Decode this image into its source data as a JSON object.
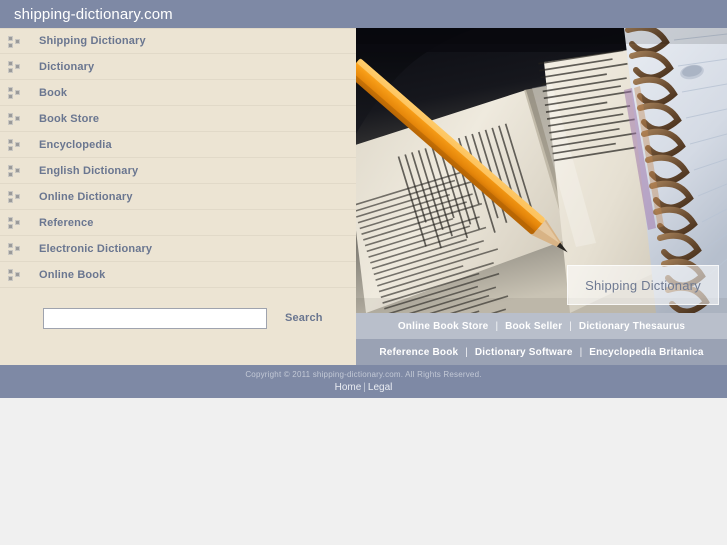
{
  "header": {
    "site_title": "shipping-dictionary.com"
  },
  "sidebar": {
    "nav_items": [
      {
        "label": "Shipping Dictionary",
        "icon": "squares-bullet-icon"
      },
      {
        "label": "Dictionary",
        "icon": "squares-bullet-icon"
      },
      {
        "label": "Book",
        "icon": "squares-bullet-icon"
      },
      {
        "label": "Book Store",
        "icon": "squares-bullet-icon"
      },
      {
        "label": "Encyclopedia",
        "icon": "squares-bullet-icon"
      },
      {
        "label": "English Dictionary",
        "icon": "squares-bullet-icon"
      },
      {
        "label": "Online Dictionary",
        "icon": "squares-bullet-icon"
      },
      {
        "label": "Reference",
        "icon": "squares-bullet-icon"
      },
      {
        "label": "Electronic Dictionary",
        "icon": "squares-bullet-icon"
      },
      {
        "label": "Online Book",
        "icon": "squares-bullet-icon"
      }
    ],
    "search": {
      "value": "",
      "placeholder": "",
      "button_label": "Search"
    }
  },
  "hero": {
    "caption": "Shipping Dictionary",
    "alt": "open dictionary with orange pencil and spiral notebook"
  },
  "linkbars": {
    "row1": [
      "Online Book Store",
      "Book Seller",
      "Dictionary Thesaurus"
    ],
    "row2": [
      "Reference Book",
      "Dictionary Software",
      "Encyclopedia Britanica"
    ],
    "separator": "|"
  },
  "footer": {
    "copyright": "Copyright © 2011 shipping-dictionary.com. All Rights Reserved.",
    "links": [
      "Home",
      "Legal"
    ],
    "separator": "|"
  },
  "colors": {
    "header_bar": "#7e89a5",
    "sidebar_bg": "#ece4d3",
    "nav_link": "#6a7690",
    "linkbar_light": "#b9bfcb",
    "linkbar_dark": "#9aa2b4",
    "footer_bar": "#7e89a5",
    "page_bg": "#f0f0f0"
  }
}
